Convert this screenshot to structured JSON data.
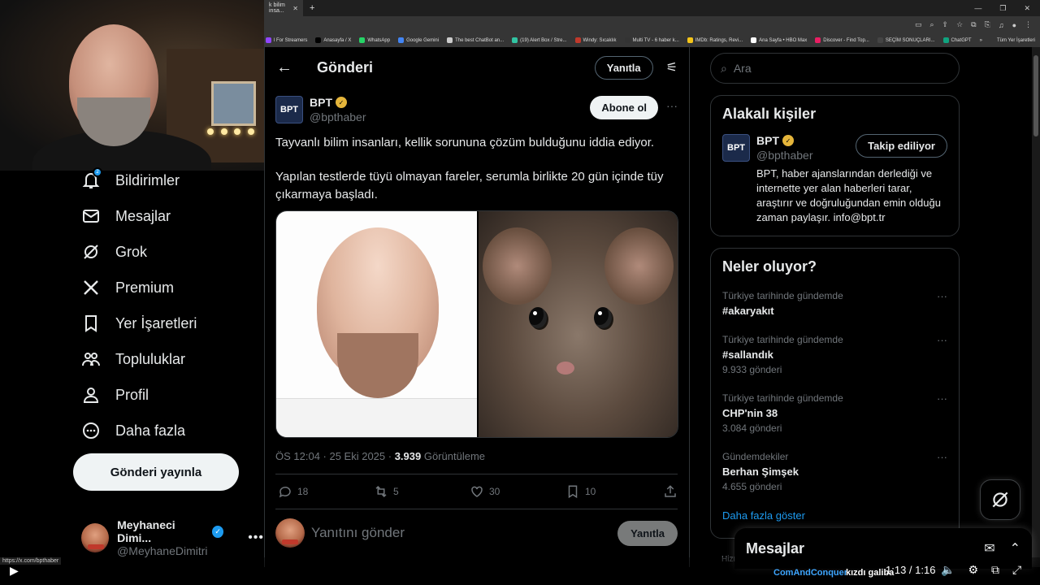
{
  "browser": {
    "tab_title": "k bilim insa...",
    "tab_close": "✕",
    "new_tab": "+",
    "bookmarks": [
      {
        "label": "l For Streamers",
        "color": "#9146ff"
      },
      {
        "label": "Anasayfa / X",
        "color": "#000000"
      },
      {
        "label": "WhatsApp",
        "color": "#25d366"
      },
      {
        "label": "Google Gemini",
        "color": "#4285f4"
      },
      {
        "label": "The best ChatBot an...",
        "color": "#cccccc"
      },
      {
        "label": "(19) Alert Box / Stre...",
        "color": "#31c3a2"
      },
      {
        "label": "Windy: Sıcaklık",
        "color": "#c0392b"
      },
      {
        "label": "Multi TV - 6 haber k...",
        "color": "#333333"
      },
      {
        "label": "IMDb: Ratings, Revi...",
        "color": "#f5c518"
      },
      {
        "label": "Ana Sayfa • HBO Max",
        "color": "#ffffff"
      },
      {
        "label": "Discover - Find Top...",
        "color": "#e91e63"
      },
      {
        "label": "SEÇİM SONUÇLARI...",
        "color": "#444444"
      },
      {
        "label": "ChatGPT",
        "color": "#10a37f"
      }
    ],
    "bookmarks_more": "»",
    "all_bookmarks": "Tüm Yer İşaretleri"
  },
  "leftnav": {
    "items": [
      {
        "label": "Bildirimler",
        "icon": "bell-icon"
      },
      {
        "label": "Mesajlar",
        "icon": "mail-icon"
      },
      {
        "label": "Grok",
        "icon": "grok-icon"
      },
      {
        "label": "Premium",
        "icon": "x-logo-icon"
      },
      {
        "label": "Yer İşaretleri",
        "icon": "bookmark-icon"
      },
      {
        "label": "Topluluklar",
        "icon": "communities-icon"
      },
      {
        "label": "Profil",
        "icon": "person-icon"
      },
      {
        "label": "Daha fazla",
        "icon": "more-circle-icon"
      }
    ],
    "notification_badge": "2",
    "post_button": "Gönderi yayınla",
    "profile": {
      "name": "Meyhaneci Dimi...",
      "handle": "@MeyhaneDimitri",
      "more": "•••"
    }
  },
  "main": {
    "header_title": "Gönderi",
    "reply_pill": "Yanıtla",
    "post": {
      "author_name": "BPT",
      "author_handle": "@bpthaber",
      "logo_text": "BPT",
      "follow_button": "Abone ol",
      "more": "···",
      "text_p1": "Tayvanlı bilim insanları, kellik sorununa çözüm bulduğunu iddia ediyor.",
      "text_p2": "Yapılan testlerde tüyü olmayan fareler, serumla birlikte 20 gün içinde tüy çıkarmaya başladı.",
      "time": "ÖS 12:04 · 25 Eki 2025 · ",
      "views": "3.939",
      "views_label": " Görüntüleme",
      "replies": "18",
      "reposts": "5",
      "likes": "30",
      "bookmarks": "10"
    },
    "reply_box": {
      "placeholder": "Yanıtını gönder",
      "button": "Yanıtla"
    }
  },
  "right": {
    "search_placeholder": "Ara",
    "related": {
      "title": "Alakalı kişiler",
      "name": "BPT",
      "handle": "@bpthaber",
      "logo_text": "BPT",
      "following_button": "Takip ediliyor",
      "bio": "BPT, haber ajanslarından derlediği ve internette yer alan haberleri tarar, araştırır ve doğruluğundan emin olduğu zaman paylaşır. info@bpt.tr"
    },
    "trends": {
      "title": "Neler oluyor?",
      "items": [
        {
          "context": "Türkiye tarihinde gündemde",
          "tag": "#akaryakıt",
          "count": ""
        },
        {
          "context": "Türkiye tarihinde gündemde",
          "tag": "#sallandık",
          "count": "9.933 gönderi"
        },
        {
          "context": "Türkiye tarihinde gündemde",
          "tag": "CHP'nin 38",
          "count": "3.084 gönderi"
        },
        {
          "context": "Gündemdekiler",
          "tag": "Berhan Şimşek",
          "count": "4.655 gönderi"
        }
      ],
      "more_dots": "···",
      "show_more": "Daha fazla göster"
    },
    "hint": "Hizm"
  },
  "messages": {
    "title": "Mesajlar"
  },
  "player": {
    "status_url": "https://x.com/bpthaber",
    "caption_user": "ComAndConquer",
    "caption_text": "kızdı galiba",
    "timecode": "1:13 / 1:16"
  }
}
